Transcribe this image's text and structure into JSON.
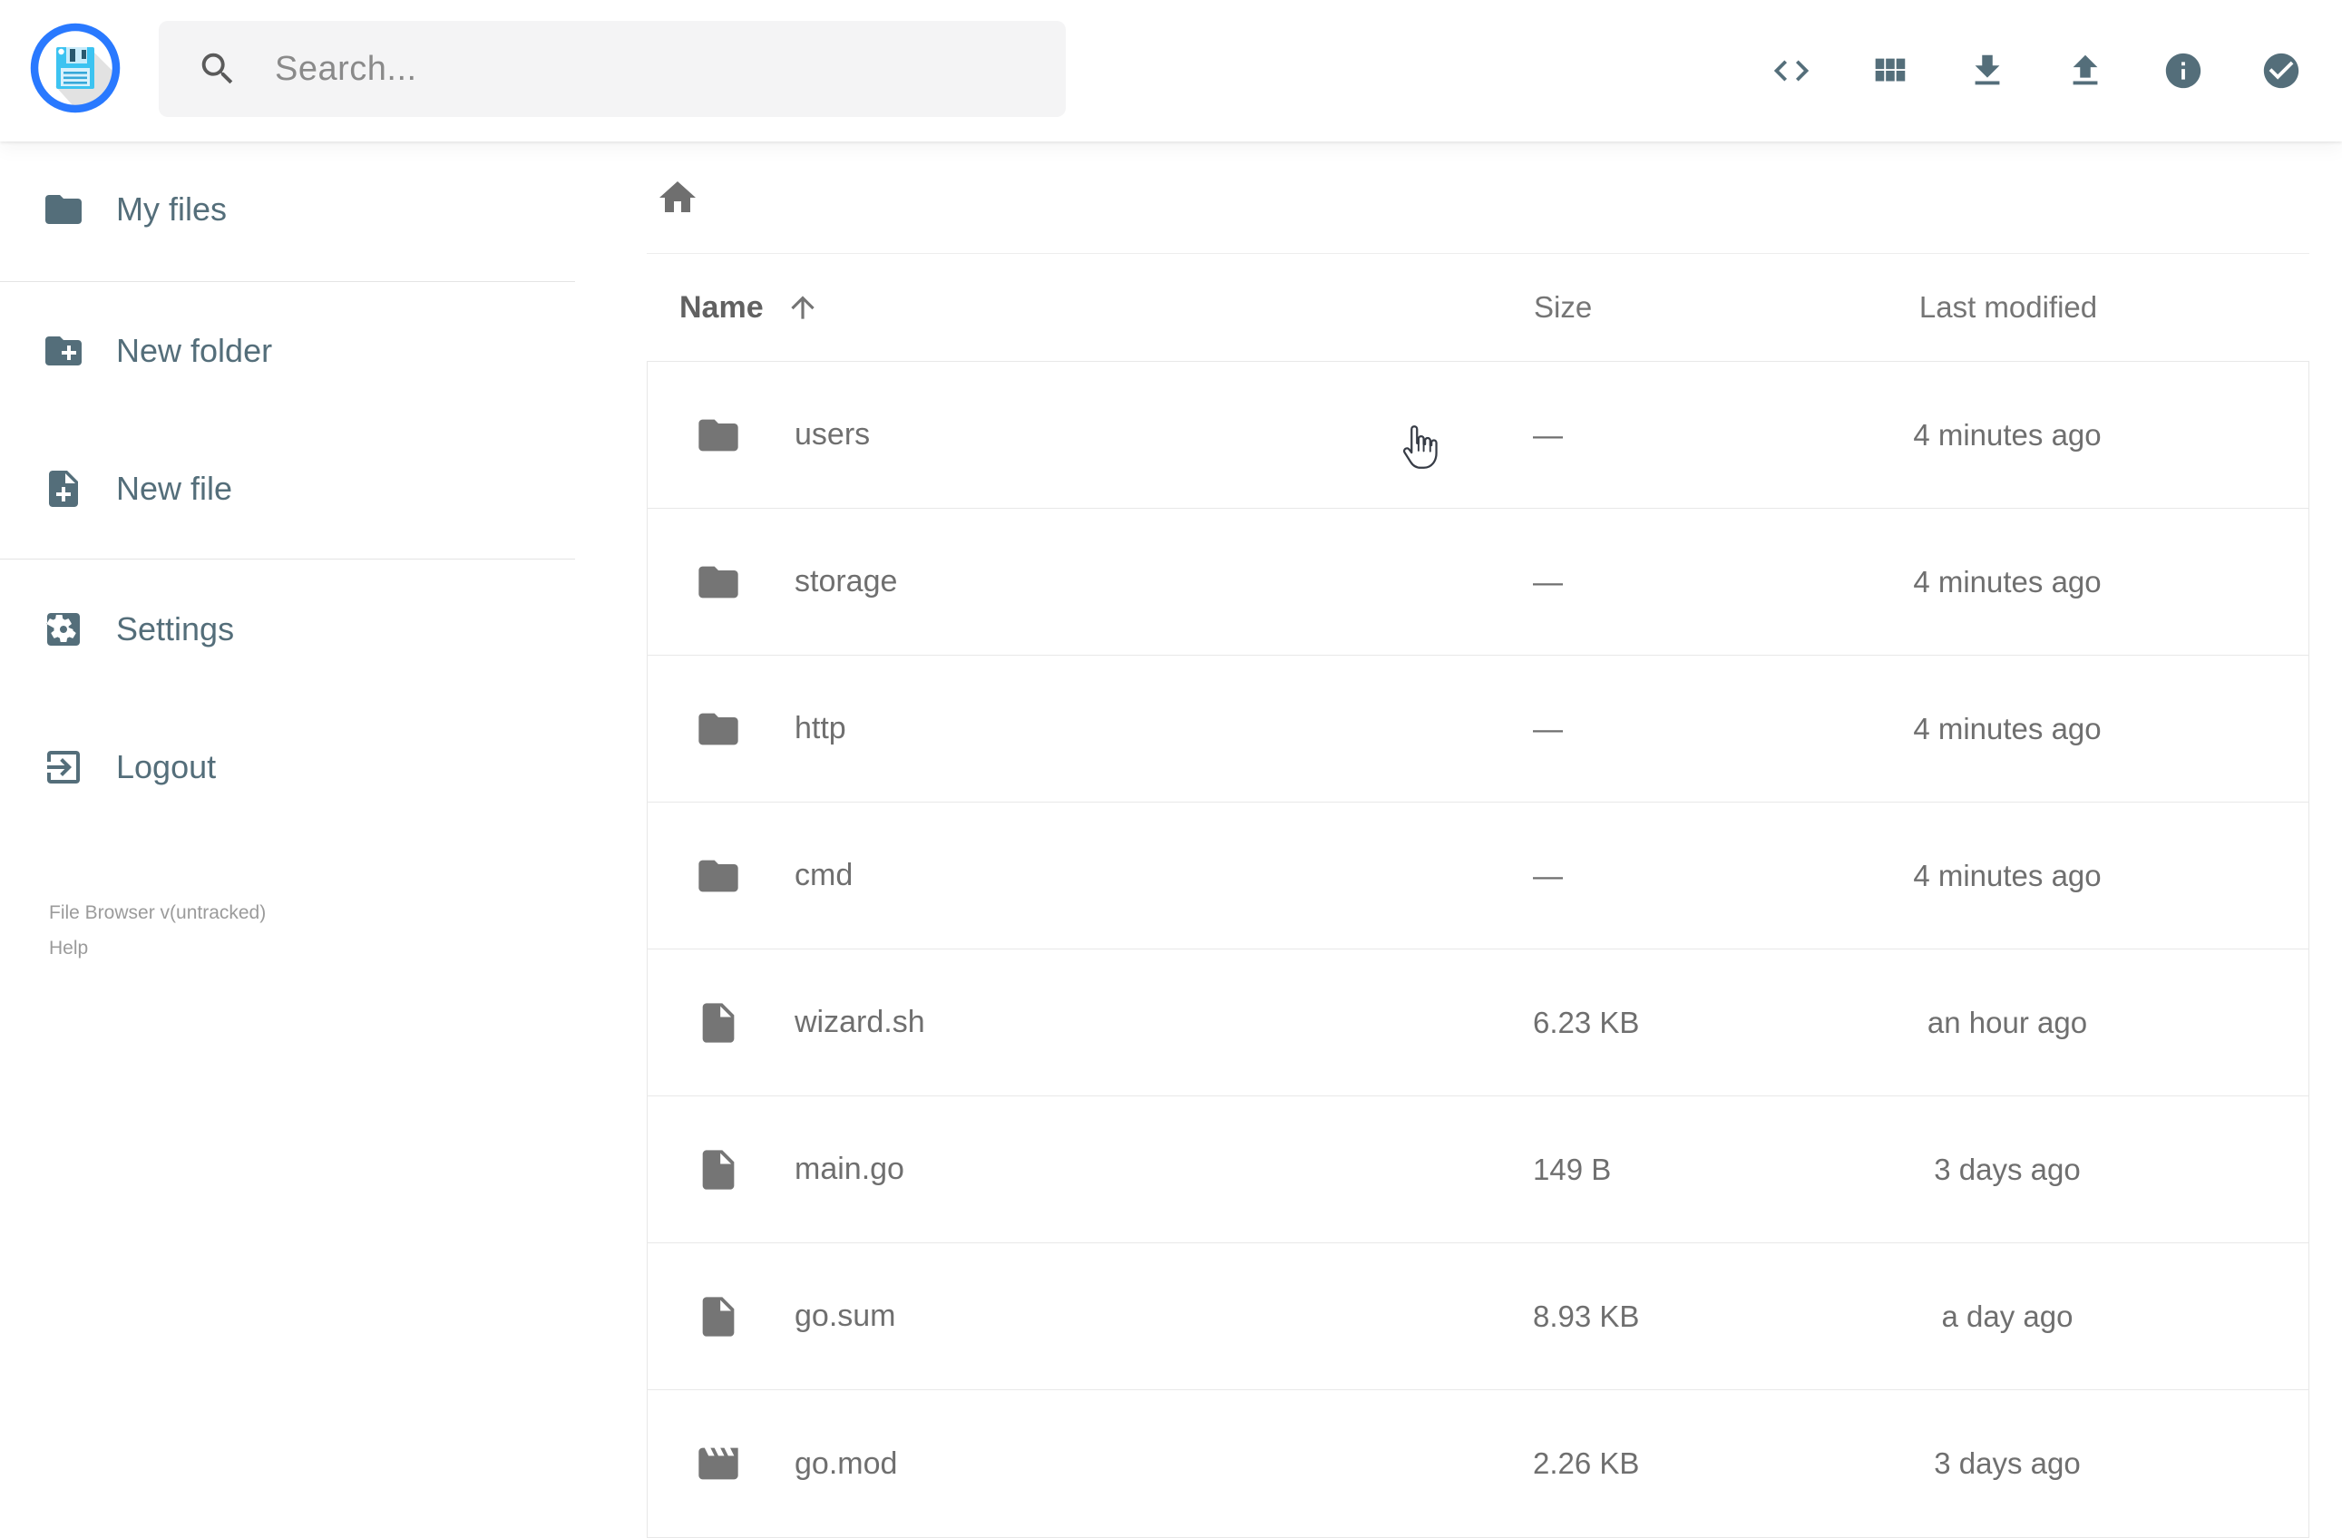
{
  "app": {
    "name": "File Browser"
  },
  "topbar": {
    "search": {
      "placeholder": "Search..."
    },
    "actions": [
      "code-icon",
      "grid-view-icon",
      "download-icon",
      "upload-icon",
      "info-icon",
      "check-circle-icon"
    ]
  },
  "sidebar": {
    "items": [
      {
        "label": "My files",
        "icon": "folder-icon"
      },
      {
        "label": "New folder",
        "icon": "new-folder-icon"
      },
      {
        "label": "New file",
        "icon": "new-file-icon"
      },
      {
        "label": "Settings",
        "icon": "settings-icon"
      },
      {
        "label": "Logout",
        "icon": "logout-icon"
      }
    ],
    "footer": {
      "version": "File Browser v(untracked)",
      "help": "Help"
    }
  },
  "breadcrumb": {
    "icon": "home-icon"
  },
  "listing": {
    "headers": {
      "name": "Name",
      "size": "Size",
      "modified": "Last modified"
    },
    "sort": {
      "column": "Name",
      "direction": "ascending"
    },
    "rows": [
      {
        "name": "users",
        "kind": "folder",
        "size": "—",
        "modified": "4 minutes ago"
      },
      {
        "name": "storage",
        "kind": "folder",
        "size": "—",
        "modified": "4 minutes ago"
      },
      {
        "name": "http",
        "kind": "folder",
        "size": "—",
        "modified": "4 minutes ago"
      },
      {
        "name": "cmd",
        "kind": "folder",
        "size": "—",
        "modified": "4 minutes ago"
      },
      {
        "name": "wizard.sh",
        "kind": "file",
        "size": "6.23 KB",
        "modified": "an hour ago"
      },
      {
        "name": "main.go",
        "kind": "file",
        "size": "149 B",
        "modified": "3 days ago"
      },
      {
        "name": "go.sum",
        "kind": "file",
        "size": "8.93 KB",
        "modified": "a day ago"
      },
      {
        "name": "go.mod",
        "kind": "movie-file",
        "size": "2.26 KB",
        "modified": "3 days ago"
      }
    ]
  },
  "colors": {
    "accent_blue": "#2979ff",
    "icon_slate": "#546e7a",
    "text_gray": "#6f6f6f",
    "muted_gray": "#9b9b9b",
    "logo_cyan": "#3cc3f1"
  }
}
